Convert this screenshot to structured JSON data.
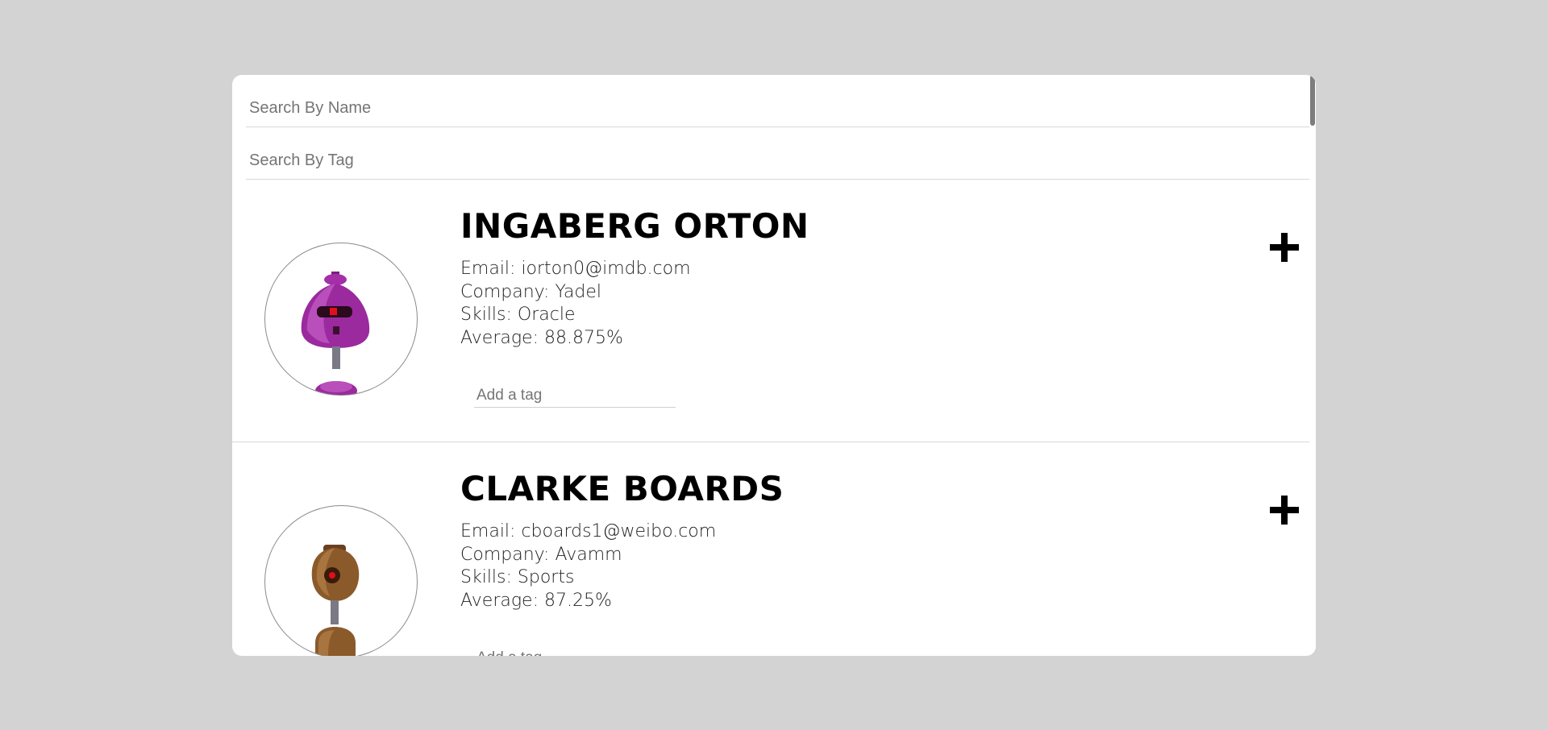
{
  "search": {
    "name_placeholder": "Search By Name",
    "tag_placeholder": "Search By Tag"
  },
  "students": [
    {
      "name": "INGABERG ORTON",
      "email": "Email: iorton0@imdb.com",
      "company": "Company: Yadel",
      "skill": "Skills: Oracle",
      "average": "Average: 88.875%",
      "tag_placeholder": "Add a tag",
      "avatar_color": "#9b2a9e",
      "avatar_icon": "robot-avatar-icon"
    },
    {
      "name": "CLARKE BOARDS",
      "email": "Email: cboards1@weibo.com",
      "company": "Company: Avamm",
      "skill": "Skills: Sports",
      "average": "Average: 87.25%",
      "tag_placeholder": "Add a tag",
      "avatar_color": "#8b5a2b",
      "avatar_icon": "robot-avatar-icon"
    }
  ],
  "colors": {
    "background": "#d3d3d3",
    "card": "#ffffff",
    "text": "#000000"
  }
}
